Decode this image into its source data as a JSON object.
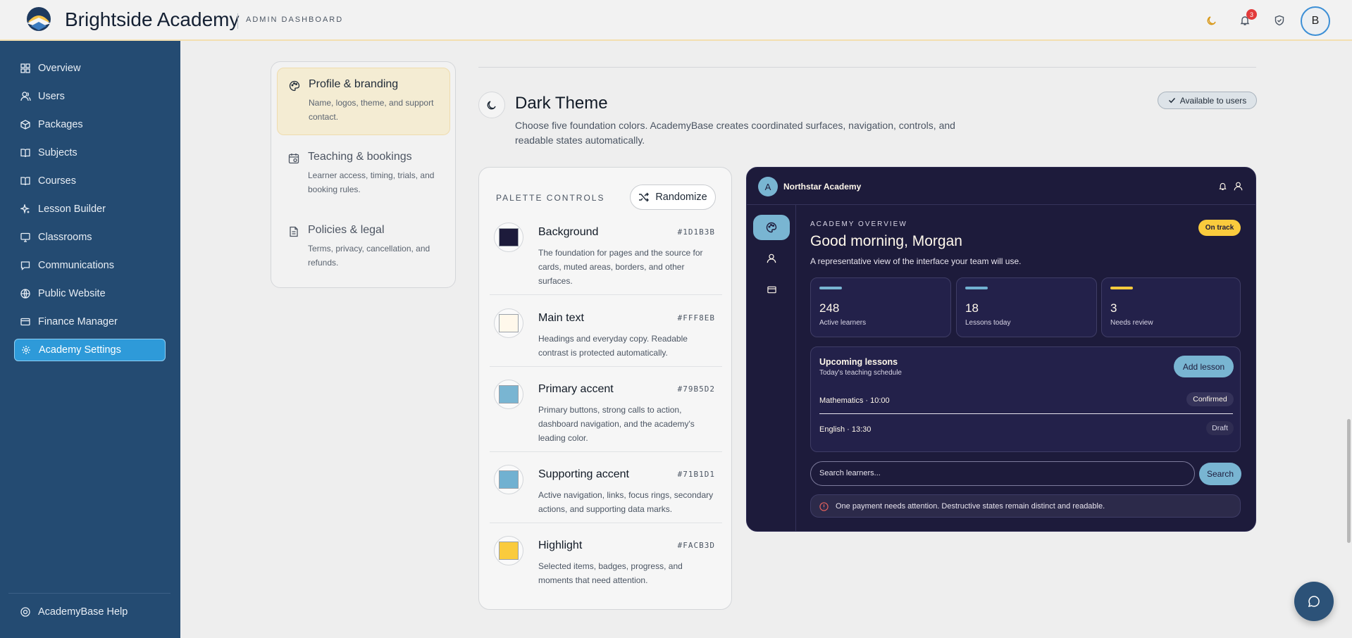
{
  "header": {
    "brand": "Brightside Academy",
    "subtitle": "ADMIN DASHBOARD",
    "notification_count": "3",
    "avatar_initial": "B"
  },
  "sidebar": {
    "items": [
      {
        "label": "Overview",
        "icon": "grid-icon"
      },
      {
        "label": "Users",
        "icon": "users-icon"
      },
      {
        "label": "Packages",
        "icon": "package-icon"
      },
      {
        "label": "Subjects",
        "icon": "book-icon"
      },
      {
        "label": "Courses",
        "icon": "book-open-icon"
      },
      {
        "label": "Lesson Builder",
        "icon": "sparkle-icon"
      },
      {
        "label": "Classrooms",
        "icon": "monitor-icon"
      },
      {
        "label": "Communications",
        "icon": "chat-icon"
      },
      {
        "label": "Public Website",
        "icon": "globe-icon"
      },
      {
        "label": "Finance Manager",
        "icon": "credit-card-icon"
      },
      {
        "label": "Academy Settings",
        "icon": "gear-icon",
        "active": true
      }
    ],
    "help": "AcademyBase Help"
  },
  "settings_nav": [
    {
      "title": "Profile & branding",
      "desc": "Name, logos, theme, and support contact.",
      "icon": "palette-icon",
      "active": true
    },
    {
      "title": "Teaching & bookings",
      "desc": "Learner access, timing, trials, and booking rules.",
      "icon": "calendar-icon"
    },
    {
      "title": "Policies & legal",
      "desc": "Terms, privacy, cancellation, and refunds.",
      "icon": "document-icon"
    }
  ],
  "theme": {
    "title": "Dark Theme",
    "description": "Choose five foundation colors. AcademyBase creates coordinated surfaces, navigation, controls, and readable states automatically.",
    "availability": "Available to users"
  },
  "palette": {
    "heading": "PALETTE CONTROLS",
    "randomize": "Randomize",
    "colors": [
      {
        "name": "Background",
        "hex": "#1D1B3B",
        "color": "#1d1b3b",
        "desc": "The foundation for pages and the source for cards, muted areas, borders, and other surfaces."
      },
      {
        "name": "Main text",
        "hex": "#FFF8EB",
        "color": "#fff8eb",
        "desc": "Headings and everyday copy. Readable contrast is protected automatically."
      },
      {
        "name": "Primary accent",
        "hex": "#79B5D2",
        "color": "#79b5d2",
        "desc": "Primary buttons, strong calls to action, dashboard navigation, and the academy's leading color."
      },
      {
        "name": "Supporting accent",
        "hex": "#71B1D1",
        "color": "#71b1d1",
        "desc": "Active navigation, links, focus rings, secondary actions, and supporting data marks."
      },
      {
        "name": "Highlight",
        "hex": "#FACB3D",
        "color": "#facb3d",
        "desc": "Selected items, badges, progress, and moments that need attention."
      }
    ]
  },
  "preview": {
    "logo_letter": "A",
    "academy_name": "Northstar Academy",
    "eyebrow": "ACADEMY OVERVIEW",
    "greeting": "Good morning, Morgan",
    "subtitle": "A representative view of the interface your team will use.",
    "status": "On track",
    "stats": [
      {
        "value": "248",
        "label": "Active learners",
        "color": "#79b5d2"
      },
      {
        "value": "18",
        "label": "Lessons today",
        "color": "#71b1d1"
      },
      {
        "value": "3",
        "label": "Needs review",
        "color": "#facb3d"
      }
    ],
    "lessons": {
      "title": "Upcoming lessons",
      "subtitle": "Today's teaching schedule",
      "add": "Add lesson",
      "rows": [
        {
          "label": "Mathematics · 10:00",
          "status": "Confirmed"
        },
        {
          "label": "English · 13:30",
          "status": "Draft"
        }
      ]
    },
    "search_placeholder": "Search learners...",
    "search_button": "Search",
    "alert": "One payment needs attention. Destructive states remain distinct and readable."
  }
}
